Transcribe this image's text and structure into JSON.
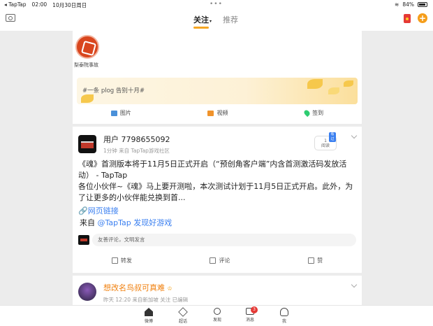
{
  "status_bar": {
    "carrier": "◂ TapTap",
    "time": "02:00",
    "date": "10月30日周日",
    "battery": "84%"
  },
  "nav": {
    "tabs": [
      {
        "label": "关注",
        "active": true
      },
      {
        "label": "推荐",
        "active": false
      }
    ],
    "icons": [
      "camera-icon",
      "red-packet-icon",
      "add-icon"
    ],
    "accent_color": "#f5a623"
  },
  "follow_strip": {
    "items": [
      {
        "name": "梨泰院事故"
      }
    ]
  },
  "composer": {
    "placeholder": "#一条 plog 告别十月#",
    "actions": [
      {
        "label": "图片",
        "icon": "image-icon"
      },
      {
        "label": "视频",
        "icon": "video-icon"
      },
      {
        "label": "签到",
        "icon": "location-icon"
      }
    ]
  },
  "feed_post": {
    "username": "用户 7798655092",
    "meta": "1分钟  来自 TapTap游戏社区",
    "read_tag": "看过",
    "read_count": "1",
    "read_label": "阅读",
    "body": "《魂》首测版本将于11月5日正式开启（“预创角客户端”内含首测激活码发放活动） - TapTap\n各位小伙伴~《魂》马上要开测啦，本次测试计划于11月5日正式开启。此外，为了让更多的小伙伴能兑换到首...",
    "link_label": "🔗网页链接",
    "from_prefix": "来自",
    "from_source": "@TapTap 发现好游戏",
    "comment_placeholder": "友善评论，文明发言",
    "actions": [
      {
        "label": "转发",
        "icon": "share-icon"
      },
      {
        "label": "评论",
        "icon": "comment-icon"
      },
      {
        "label": "赞",
        "icon": "like-icon"
      }
    ],
    "link_color": "#3a7ff0"
  },
  "next_post": {
    "username": "想改名鸟叔可真难",
    "meta": "昨天 12:20  来自新加坡 关注  已编辑"
  },
  "tab_bar": {
    "items": [
      {
        "label": "微博",
        "icon": "home-icon"
      },
      {
        "label": "超话",
        "icon": "diamond-icon"
      },
      {
        "label": "发现",
        "icon": "search-icon"
      },
      {
        "label": "消息",
        "icon": "message-icon",
        "badge": "3"
      },
      {
        "label": "我",
        "icon": "profile-icon"
      }
    ]
  }
}
